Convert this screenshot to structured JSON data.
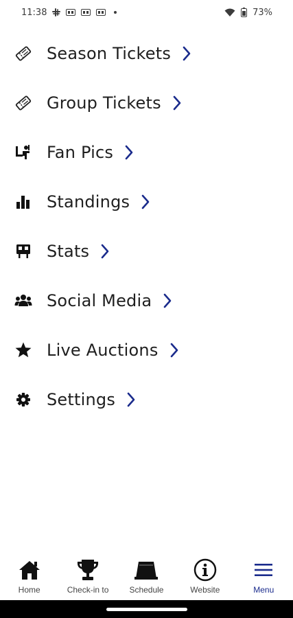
{
  "status_bar": {
    "time": "11:38",
    "battery": "73%"
  },
  "menu": {
    "chevron_color": "#1a2b8c",
    "items": [
      {
        "label": "Season Tickets",
        "icon": "ticket-icon"
      },
      {
        "label": "Group Tickets",
        "icon": "ticket-icon"
      },
      {
        "label": "Fan Pics",
        "icon": "fan-pics-icon"
      },
      {
        "label": "Standings",
        "icon": "bar-chart-icon"
      },
      {
        "label": "Stats",
        "icon": "scoreboard-icon"
      },
      {
        "label": "Social Media",
        "icon": "people-icon"
      },
      {
        "label": "Live Auctions",
        "icon": "star-icon"
      },
      {
        "label": "Settings",
        "icon": "gear-icon"
      }
    ]
  },
  "bottom_nav": {
    "active_color": "#1a2b8c",
    "items": [
      {
        "label": "Home",
        "icon": "home-icon",
        "active": false
      },
      {
        "label": "Check-in to",
        "icon": "trophy-icon",
        "active": false
      },
      {
        "label": "Schedule",
        "icon": "schedule-icon",
        "active": false
      },
      {
        "label": "Website",
        "icon": "info-icon",
        "active": false
      },
      {
        "label": "Menu",
        "icon": "menu-icon",
        "active": true
      }
    ]
  }
}
